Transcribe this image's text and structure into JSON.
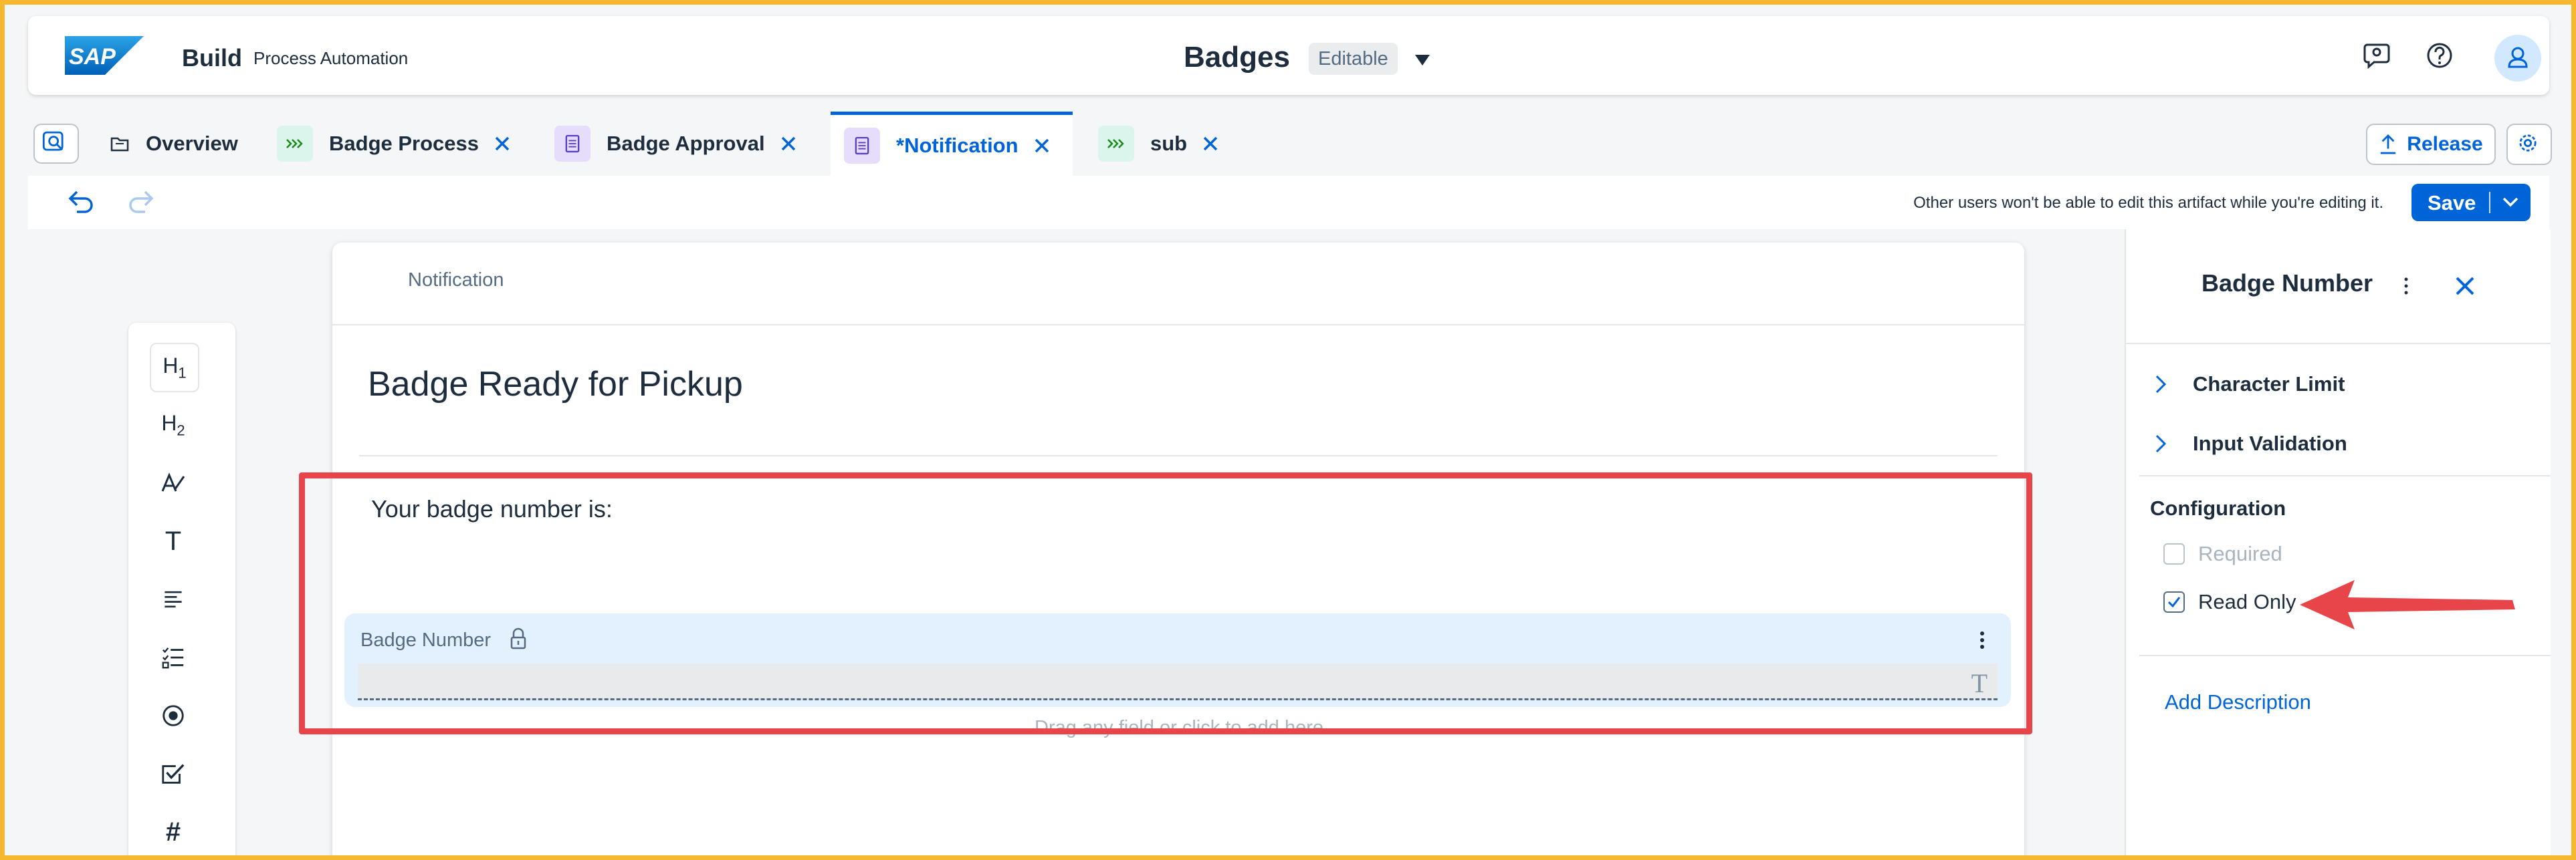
{
  "shell": {
    "logo_text": "SAP",
    "brand": "Build",
    "brand_sub": "Process Automation",
    "title": "Badges",
    "status": "Editable"
  },
  "tabs": [
    {
      "label": "Overview",
      "icon": "folder-icon"
    },
    {
      "label": "Badge Process",
      "icon": "process-icon"
    },
    {
      "label": "Badge Approval",
      "icon": "form-icon"
    },
    {
      "label": "*Notification",
      "icon": "form-icon"
    },
    {
      "label": "sub",
      "icon": "process-icon"
    }
  ],
  "tabbar": {
    "release_label": "Release"
  },
  "toolbar": {
    "message": "Other users won't be able to edit this artifact while you're editing it.",
    "save_label": "Save"
  },
  "palette": {
    "items": [
      "H1",
      "H2",
      "rich-text",
      "T",
      "paragraph",
      "checklist",
      "radio",
      "checkbox",
      "#"
    ]
  },
  "form": {
    "header_label": "Notification",
    "title": "Badge Ready for Pickup",
    "text": "Your badge number is:",
    "field_label": "Badge Number",
    "drop_hint": "Drag any field or click to add here"
  },
  "panel": {
    "title": "Badge Number",
    "accordions": [
      "Character Limit",
      "Input Validation"
    ],
    "section": "Configuration",
    "options": [
      {
        "label": "Required",
        "checked": false,
        "disabled": true
      },
      {
        "label": "Read Only",
        "checked": true,
        "disabled": false
      }
    ],
    "add_description": "Add Description"
  },
  "colors": {
    "accent": "#0064d9",
    "highlight": "#e8454b",
    "frame": "#f5b82e",
    "field_bg": "#e3f1ff"
  }
}
